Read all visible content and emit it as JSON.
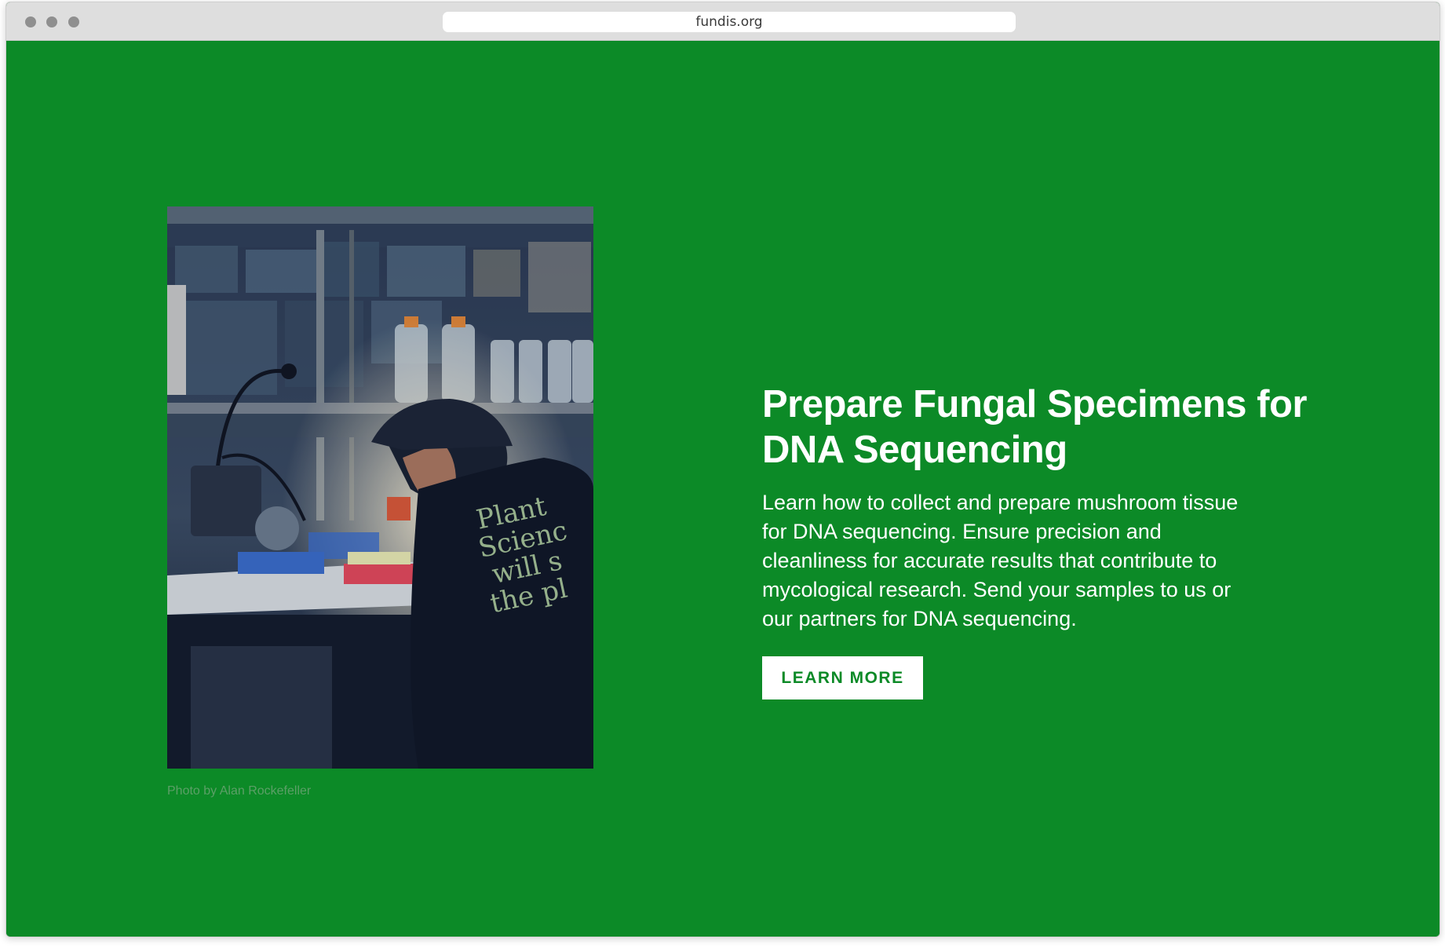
{
  "browser": {
    "url": "fundis.org"
  },
  "hero": {
    "title": "Prepare Fungal Specimens for DNA Sequencing",
    "description": "Learn how to collect and prepare mushroom tissue for DNA sequencing. Ensure precision and cleanliness for accurate results that contribute to mycological research. Send your samples to us or our partners for DNA sequencing.",
    "button_label": "LEARN MORE",
    "photo_credit": "Photo by Alan Rockefeller",
    "photo_shirt_text": [
      "Plant",
      "Scienc",
      "will s",
      "the pl"
    ]
  },
  "colors": {
    "background": "#0c8a27",
    "button_bg": "#ffffff",
    "button_text": "#0c8a27"
  }
}
